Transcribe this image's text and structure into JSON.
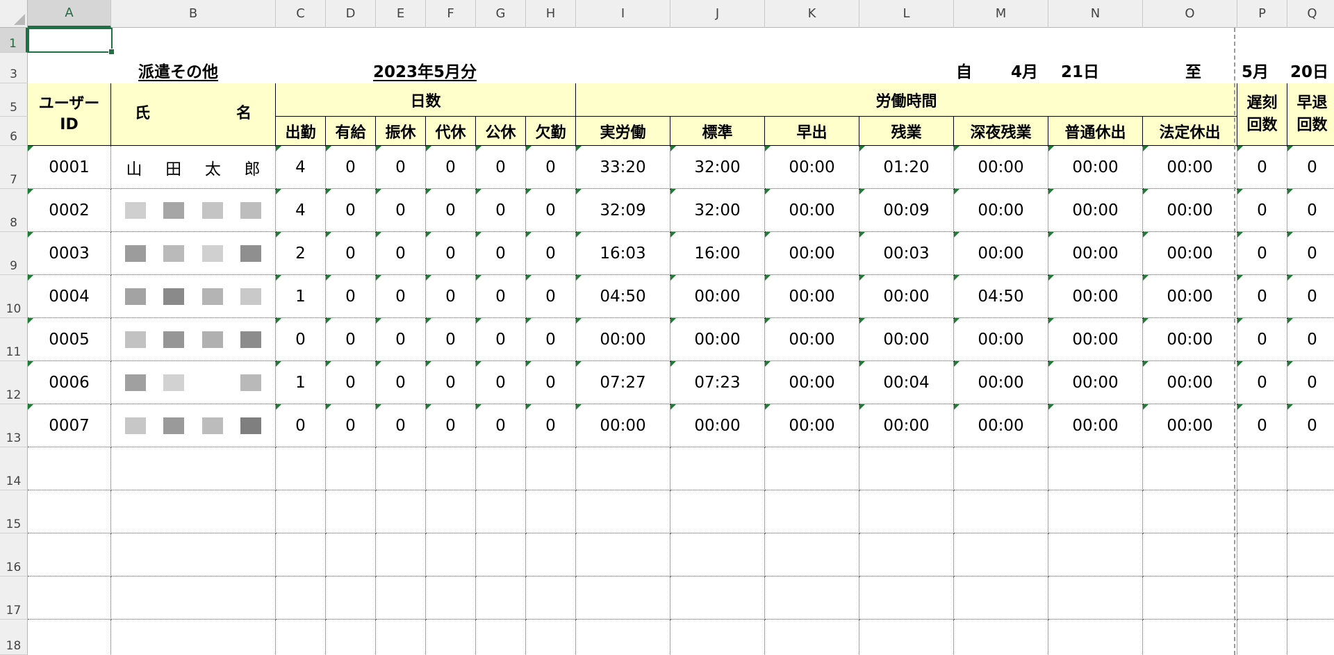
{
  "columns": [
    "A",
    "B",
    "C",
    "D",
    "E",
    "F",
    "G",
    "H",
    "I",
    "J",
    "K",
    "L",
    "M",
    "N",
    "O",
    "P",
    "Q"
  ],
  "rows": [
    "1",
    "3",
    "5",
    "6",
    "7",
    "8",
    "9",
    "10",
    "11",
    "12",
    "13",
    "14",
    "15",
    "16",
    "17",
    "18"
  ],
  "title": {
    "category": "派遣その他",
    "month": "2023年5月分",
    "from_label": "自",
    "from_month": "4月",
    "from_day": "21日",
    "to_label": "至",
    "to_month": "5月",
    "to_day": "20日"
  },
  "headers": {
    "user_id_top": "ユーザー",
    "user_id_bottom": "ID",
    "name_family": "氏",
    "name_given": "名",
    "days_group": "日数",
    "days": [
      "出勤",
      "有給",
      "振休",
      "代休",
      "公休",
      "欠勤"
    ],
    "hours_group": "労働時間",
    "hours": [
      "実労働",
      "標準",
      "早出",
      "残業",
      "深夜残業",
      "普通休出",
      "法定休出"
    ],
    "late_top": "遅刻",
    "late_bottom": "回数",
    "early_top": "早退",
    "early_bottom": "回数"
  },
  "records": [
    {
      "id": "0001",
      "name": [
        "山",
        "田",
        "太",
        "郎"
      ],
      "days": [
        "4",
        "0",
        "0",
        "0",
        "0",
        "0"
      ],
      "hours": [
        "33:20",
        "32:00",
        "00:00",
        "01:20",
        "00:00",
        "00:00",
        "00:00"
      ],
      "late": "0",
      "early": "0"
    },
    {
      "id": "0002",
      "name": null,
      "days": [
        "4",
        "0",
        "0",
        "0",
        "0",
        "0"
      ],
      "hours": [
        "32:09",
        "32:00",
        "00:00",
        "00:09",
        "00:00",
        "00:00",
        "00:00"
      ],
      "late": "0",
      "early": "0"
    },
    {
      "id": "0003",
      "name": null,
      "days": [
        "2",
        "0",
        "0",
        "0",
        "0",
        "0"
      ],
      "hours": [
        "16:03",
        "16:00",
        "00:00",
        "00:03",
        "00:00",
        "00:00",
        "00:00"
      ],
      "late": "0",
      "early": "0"
    },
    {
      "id": "0004",
      "name": null,
      "days": [
        "1",
        "0",
        "0",
        "0",
        "0",
        "0"
      ],
      "hours": [
        "04:50",
        "00:00",
        "00:00",
        "00:00",
        "04:50",
        "00:00",
        "00:00"
      ],
      "late": "0",
      "early": "0"
    },
    {
      "id": "0005",
      "name": null,
      "days": [
        "0",
        "0",
        "0",
        "0",
        "0",
        "0"
      ],
      "hours": [
        "00:00",
        "00:00",
        "00:00",
        "00:00",
        "00:00",
        "00:00",
        "00:00"
      ],
      "late": "0",
      "early": "0"
    },
    {
      "id": "0006",
      "name": null,
      "days": [
        "1",
        "0",
        "0",
        "0",
        "0",
        "0"
      ],
      "hours": [
        "07:27",
        "07:23",
        "00:00",
        "00:04",
        "00:00",
        "00:00",
        "00:00"
      ],
      "late": "0",
      "early": "0"
    },
    {
      "id": "0007",
      "name": null,
      "days": [
        "0",
        "0",
        "0",
        "0",
        "0",
        "0"
      ],
      "hours": [
        "00:00",
        "00:00",
        "00:00",
        "00:00",
        "00:00",
        "00:00",
        "00:00"
      ],
      "late": "0",
      "early": "0"
    }
  ],
  "colors": {
    "header_fill": "#ffffcc",
    "selection": "#1e7145",
    "gridline_header": "#c8c8c8"
  }
}
